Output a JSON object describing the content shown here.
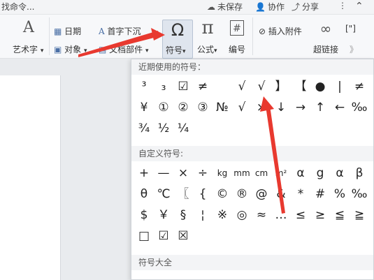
{
  "topbar": {
    "search_text": "找命令...",
    "unsaved": "未保存",
    "collab": "协作",
    "share": "分享",
    "more": "⋮"
  },
  "ribbon": {
    "wordart_label": "艺术字",
    "date_label": "日期",
    "dropcap_label": "首字下沉",
    "object_label": "对象",
    "textpart_label": "文档部件",
    "symbol_label": "符号",
    "formula_label": "公式",
    "numbering_label": "编号",
    "attachment_label": "插入附件",
    "hyperlink_label": "超链接",
    "omega_glyph": "Ω",
    "pi_glyph": "π",
    "hash_glyph": "#",
    "wordart_glyph": "A",
    "dropcap_glyph": "A",
    "paperclip_glyph": "⊘",
    "link_glyph": "∞",
    "bracket_label": "[\"]",
    "right_glyph": "》"
  },
  "panel": {
    "recent_title": "近期使用的符号：",
    "custom_title": "自定义符号:",
    "all_title": "符号大全",
    "recent_rows": [
      [
        "³",
        "₃",
        "☑",
        "≠",
        " ",
        "√",
        "√",
        "】",
        "【",
        "●",
        "|",
        "≠"
      ],
      [
        "¥",
        "①",
        "②",
        "③",
        "№",
        "√",
        "×",
        "↓",
        "→",
        "↑",
        "←",
        "‰"
      ],
      [
        "¾",
        "½",
        "¼"
      ]
    ],
    "custom_rows": [
      [
        "+",
        "—",
        "×",
        "÷",
        "kg",
        "mm",
        "cm",
        "m²",
        "α",
        "g",
        "α",
        "β"
      ],
      [
        "θ",
        "℃",
        "〖",
        "{",
        "©",
        "®",
        "@",
        "&",
        "*",
        "#",
        "%",
        "‰"
      ],
      [
        "$",
        "￥",
        "§",
        "¦",
        "※",
        "◎",
        "≈",
        "…",
        "≤",
        "≥",
        "≦",
        "≧"
      ],
      [
        "□",
        "☑",
        "☒"
      ]
    ]
  }
}
